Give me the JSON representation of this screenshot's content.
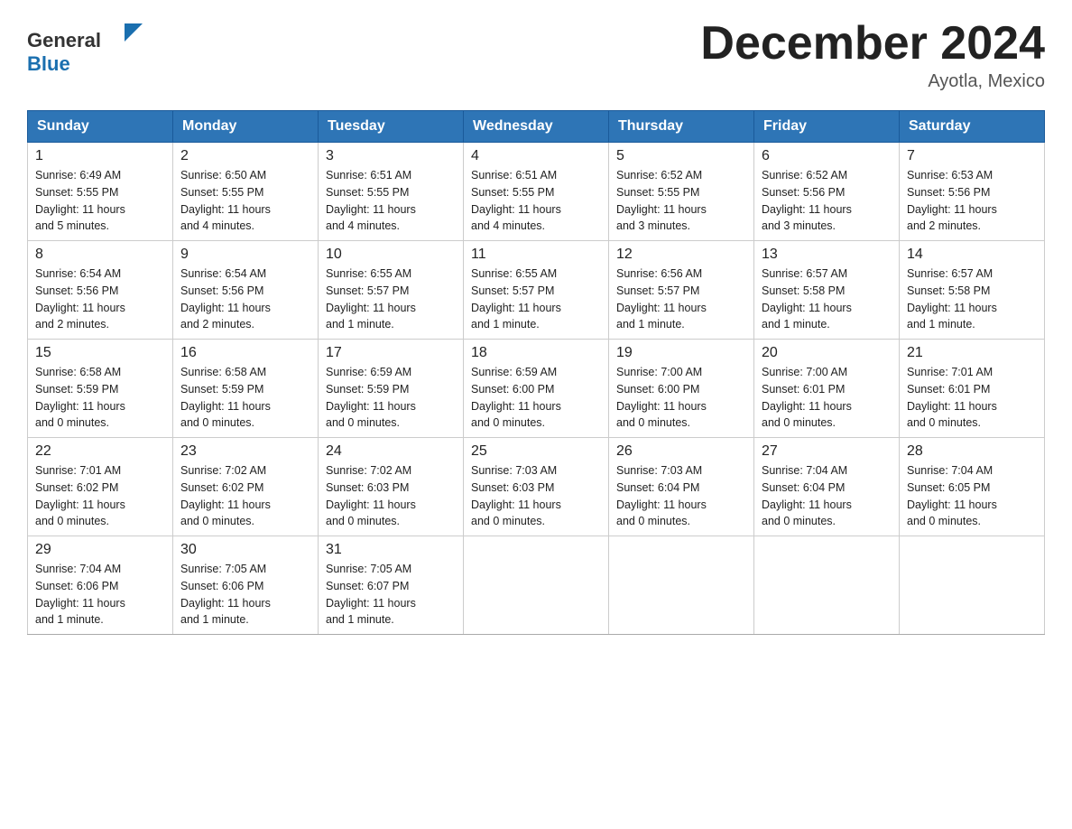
{
  "header": {
    "logo_general": "General",
    "logo_blue": "Blue",
    "month_title": "December 2024",
    "location": "Ayotla, Mexico"
  },
  "weekdays": [
    "Sunday",
    "Monday",
    "Tuesday",
    "Wednesday",
    "Thursday",
    "Friday",
    "Saturday"
  ],
  "weeks": [
    [
      {
        "day": "1",
        "sunrise": "6:49 AM",
        "sunset": "5:55 PM",
        "daylight": "11 hours and 5 minutes."
      },
      {
        "day": "2",
        "sunrise": "6:50 AM",
        "sunset": "5:55 PM",
        "daylight": "11 hours and 4 minutes."
      },
      {
        "day": "3",
        "sunrise": "6:51 AM",
        "sunset": "5:55 PM",
        "daylight": "11 hours and 4 minutes."
      },
      {
        "day": "4",
        "sunrise": "6:51 AM",
        "sunset": "5:55 PM",
        "daylight": "11 hours and 4 minutes."
      },
      {
        "day": "5",
        "sunrise": "6:52 AM",
        "sunset": "5:55 PM",
        "daylight": "11 hours and 3 minutes."
      },
      {
        "day": "6",
        "sunrise": "6:52 AM",
        "sunset": "5:56 PM",
        "daylight": "11 hours and 3 minutes."
      },
      {
        "day": "7",
        "sunrise": "6:53 AM",
        "sunset": "5:56 PM",
        "daylight": "11 hours and 2 minutes."
      }
    ],
    [
      {
        "day": "8",
        "sunrise": "6:54 AM",
        "sunset": "5:56 PM",
        "daylight": "11 hours and 2 minutes."
      },
      {
        "day": "9",
        "sunrise": "6:54 AM",
        "sunset": "5:56 PM",
        "daylight": "11 hours and 2 minutes."
      },
      {
        "day": "10",
        "sunrise": "6:55 AM",
        "sunset": "5:57 PM",
        "daylight": "11 hours and 1 minute."
      },
      {
        "day": "11",
        "sunrise": "6:55 AM",
        "sunset": "5:57 PM",
        "daylight": "11 hours and 1 minute."
      },
      {
        "day": "12",
        "sunrise": "6:56 AM",
        "sunset": "5:57 PM",
        "daylight": "11 hours and 1 minute."
      },
      {
        "day": "13",
        "sunrise": "6:57 AM",
        "sunset": "5:58 PM",
        "daylight": "11 hours and 1 minute."
      },
      {
        "day": "14",
        "sunrise": "6:57 AM",
        "sunset": "5:58 PM",
        "daylight": "11 hours and 1 minute."
      }
    ],
    [
      {
        "day": "15",
        "sunrise": "6:58 AM",
        "sunset": "5:59 PM",
        "daylight": "11 hours and 0 minutes."
      },
      {
        "day": "16",
        "sunrise": "6:58 AM",
        "sunset": "5:59 PM",
        "daylight": "11 hours and 0 minutes."
      },
      {
        "day": "17",
        "sunrise": "6:59 AM",
        "sunset": "5:59 PM",
        "daylight": "11 hours and 0 minutes."
      },
      {
        "day": "18",
        "sunrise": "6:59 AM",
        "sunset": "6:00 PM",
        "daylight": "11 hours and 0 minutes."
      },
      {
        "day": "19",
        "sunrise": "7:00 AM",
        "sunset": "6:00 PM",
        "daylight": "11 hours and 0 minutes."
      },
      {
        "day": "20",
        "sunrise": "7:00 AM",
        "sunset": "6:01 PM",
        "daylight": "11 hours and 0 minutes."
      },
      {
        "day": "21",
        "sunrise": "7:01 AM",
        "sunset": "6:01 PM",
        "daylight": "11 hours and 0 minutes."
      }
    ],
    [
      {
        "day": "22",
        "sunrise": "7:01 AM",
        "sunset": "6:02 PM",
        "daylight": "11 hours and 0 minutes."
      },
      {
        "day": "23",
        "sunrise": "7:02 AM",
        "sunset": "6:02 PM",
        "daylight": "11 hours and 0 minutes."
      },
      {
        "day": "24",
        "sunrise": "7:02 AM",
        "sunset": "6:03 PM",
        "daylight": "11 hours and 0 minutes."
      },
      {
        "day": "25",
        "sunrise": "7:03 AM",
        "sunset": "6:03 PM",
        "daylight": "11 hours and 0 minutes."
      },
      {
        "day": "26",
        "sunrise": "7:03 AM",
        "sunset": "6:04 PM",
        "daylight": "11 hours and 0 minutes."
      },
      {
        "day": "27",
        "sunrise": "7:04 AM",
        "sunset": "6:04 PM",
        "daylight": "11 hours and 0 minutes."
      },
      {
        "day": "28",
        "sunrise": "7:04 AM",
        "sunset": "6:05 PM",
        "daylight": "11 hours and 0 minutes."
      }
    ],
    [
      {
        "day": "29",
        "sunrise": "7:04 AM",
        "sunset": "6:06 PM",
        "daylight": "11 hours and 1 minute."
      },
      {
        "day": "30",
        "sunrise": "7:05 AM",
        "sunset": "6:06 PM",
        "daylight": "11 hours and 1 minute."
      },
      {
        "day": "31",
        "sunrise": "7:05 AM",
        "sunset": "6:07 PM",
        "daylight": "11 hours and 1 minute."
      },
      null,
      null,
      null,
      null
    ]
  ],
  "labels": {
    "sunrise": "Sunrise:",
    "sunset": "Sunset:",
    "daylight": "Daylight:"
  }
}
